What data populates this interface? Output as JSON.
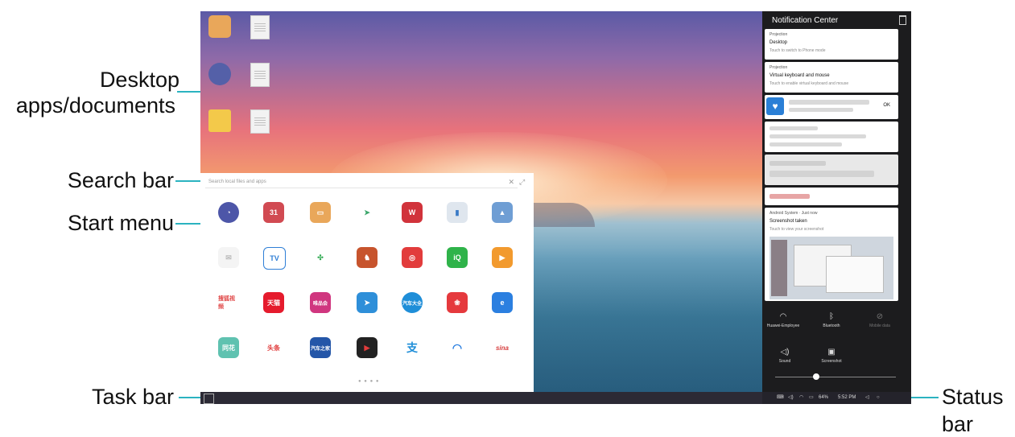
{
  "callouts": {
    "desktop_line1": "Desktop",
    "desktop_line2": "apps/documents",
    "search_bar": "Search bar",
    "start_menu": "Start menu",
    "task_bar": "Task bar",
    "status_line1": "Status",
    "status_line2": "bar"
  },
  "start_menu": {
    "search_placeholder": "Search local files and apps",
    "calendar_day": "31",
    "row3_labels": [
      "搜狐视频",
      "天猫",
      "唯品会",
      "",
      "汽车大全",
      "",
      ""
    ],
    "row4_labels": [
      "同花",
      "头条",
      "汽车之家",
      "",
      "支",
      "",
      "sina"
    ]
  },
  "notification_center": {
    "title": "Notification Center",
    "card1": {
      "source": "Projection",
      "title": "Desktop",
      "subtitle": "Touch to switch to Phone mode"
    },
    "card2": {
      "source": "Projection",
      "title": "Virtual keyboard and mouse",
      "subtitle": "Touch to enable virtual keyboard and mouse"
    },
    "card3": {
      "action": "OK"
    },
    "card7": {
      "source": "Android System · Just now",
      "title": "Screenshot taken",
      "subtitle": "Touch to view your screenshot"
    },
    "quick_settings": {
      "wifi": "Huawei-Employee",
      "bluetooth": "Bluetooth",
      "mobile_data": "Mobile data",
      "sound": "Sound",
      "screenshot": "Screenshot"
    }
  },
  "status_bar": {
    "battery": "64%",
    "time": "5:52 PM"
  },
  "colors": {
    "accent": "#2bb3c0"
  }
}
